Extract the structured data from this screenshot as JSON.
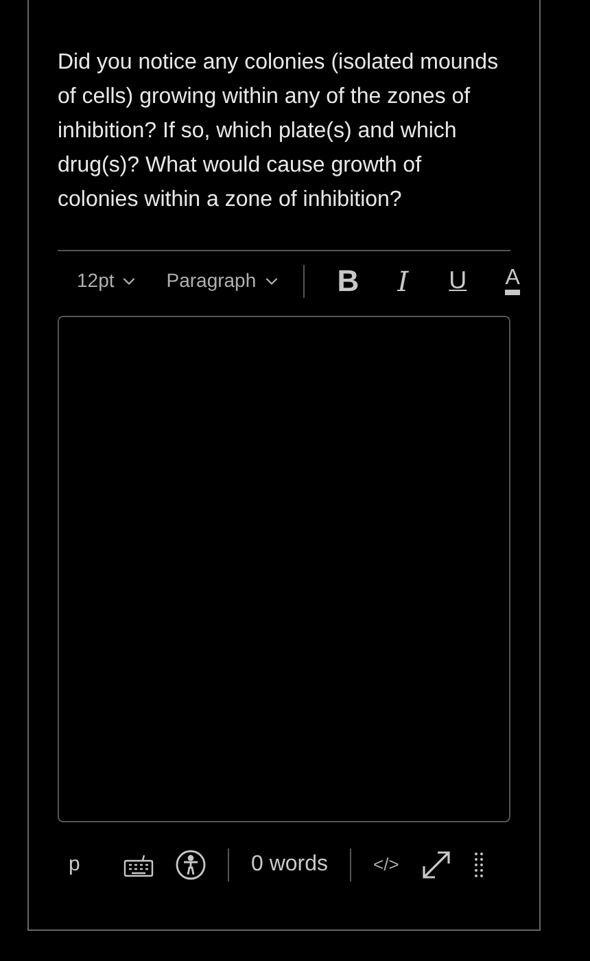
{
  "question": "Did you notice any colonies (isolated mounds of cells) growing within any of the zones of inhibition? If so, which plate(s) and which drug(s)? What would cause growth of colonies within a zone of inhibition?",
  "toolbar": {
    "font_size": "12pt",
    "block_format": "Paragraph",
    "buttons": [
      {
        "kind": "bold",
        "label": "B"
      },
      {
        "kind": "italic",
        "label": "I"
      },
      {
        "kind": "underline",
        "label": "U"
      },
      {
        "kind": "color",
        "label": "A"
      }
    ]
  },
  "status_bar": {
    "element_path": "p",
    "word_count": "0 words",
    "html_toggle": "</>"
  }
}
